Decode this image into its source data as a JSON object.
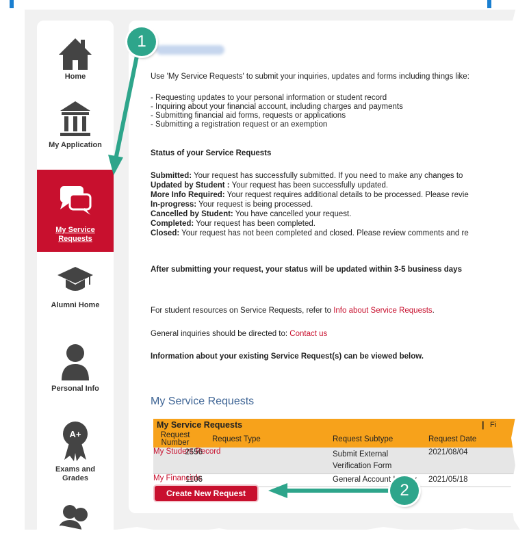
{
  "nav": [
    {
      "id": "home",
      "label": "Home",
      "icon": "home-icon"
    },
    {
      "id": "my-application",
      "label": "My Application",
      "icon": "institution-icon"
    },
    {
      "id": "my-service-requests",
      "label": "My Service Requests",
      "icon": "chat-bubbles-icon",
      "active": true
    },
    {
      "id": "alumni-home",
      "label": "Alumni Home",
      "icon": "graduation-cap-icon"
    },
    {
      "id": "personal-info",
      "label": "Personal Info",
      "icon": "person-icon"
    },
    {
      "id": "exams-grades",
      "label": "Exams and Grades",
      "icon": "award-ribbon-icon"
    }
  ],
  "intro": "Use 'My Service Requests' to submit your inquiries, updates and forms including things like:",
  "bullets": [
    "- Requesting updates to your personal information or student record",
    "- Inquiring about your financial account, including charges and payments",
    "- Submitting financial aid forms, requests or applications",
    "- Submitting a registration request or an exemption"
  ],
  "status_title": "Status of your Service Requests",
  "statuses": [
    {
      "term": "Submitted:",
      "desc": " Your request has successfully submitted. If you need to make any changes to"
    },
    {
      "term": "Updated by Student :",
      "desc": " Your request has been successfully updated."
    },
    {
      "term": "More Info Required:",
      "desc": " Your request requires additional details to be processed. Please revie"
    },
    {
      "term": "In-progress:",
      "desc": " Your request is being processed."
    },
    {
      "term": "Cancelled by Student:",
      "desc": " You have cancelled your request."
    },
    {
      "term": "Completed:",
      "desc": " Your request has been completed."
    },
    {
      "term": "Closed:",
      "desc": " Your request has not been completed and closed. Please review comments and re"
    }
  ],
  "after_submit": "After submitting your request, your status will be updated within 3-5 business days",
  "resources_prefix": "For student resources on Service Requests, refer to ",
  "resources_link": "Info about Service Requests",
  "resources_suffix": ".",
  "inquiries_prefix": "General inquiries should be directed to: ",
  "inquiries_link": "Contact us",
  "info_existing": "Information about your existing Service Request(s) can be viewed below.",
  "section_title": "My Service Requests",
  "table": {
    "title": "My Service Requests",
    "right_pipe": "|",
    "right_text": "Fi",
    "columns": [
      "Request Number",
      "Request Type",
      "Request Subtype",
      "Request Date"
    ],
    "rows": [
      {
        "number": "2556",
        "type": "My Student Record",
        "subtype": "Submit External Verification Form",
        "date": "2021/08/04"
      },
      {
        "number": "1106",
        "type": "My Financials",
        "subtype": "General Account Inquiry",
        "date": "2021/05/18"
      }
    ]
  },
  "create_button": "Create New Request",
  "callouts": [
    "1",
    "2"
  ],
  "colors": {
    "accent_red": "#c8102e",
    "table_orange": "#f7a21b",
    "callout_green": "#2ea58b",
    "link_blue": "#3f6595"
  }
}
